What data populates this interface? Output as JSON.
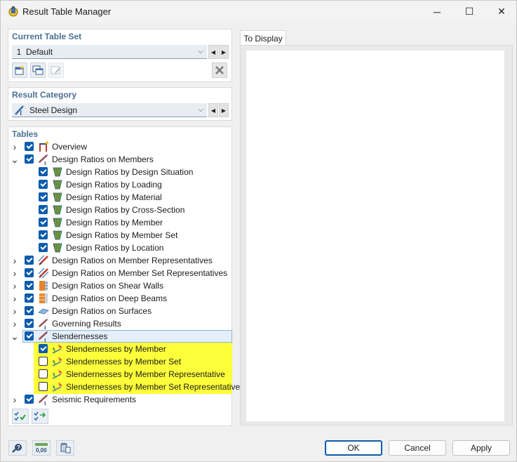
{
  "window": {
    "title": "Result Table Manager",
    "minimize_glyph": "─",
    "maximize_glyph": "☐",
    "close_glyph": "✕"
  },
  "table_set": {
    "section_title": "Current Table Set",
    "number": "1",
    "value": "Default"
  },
  "result_category": {
    "section_title": "Result Category",
    "value": "Steel Design"
  },
  "tables": {
    "section_title": "Tables",
    "items": [
      {
        "label": "Overview",
        "level": 0,
        "expander": "collapsed",
        "checked": true,
        "icon": "overview-icon"
      },
      {
        "label": "Design Ratios on Members",
        "level": 0,
        "expander": "expanded",
        "checked": true,
        "icon": "member-icon"
      },
      {
        "label": "Design Ratios by Design Situation",
        "level": 1,
        "checked": true,
        "icon": "design-ratio-icon"
      },
      {
        "label": "Design Ratios by Loading",
        "level": 1,
        "checked": true,
        "icon": "design-ratio-icon"
      },
      {
        "label": "Design Ratios by Material",
        "level": 1,
        "checked": true,
        "icon": "design-ratio-icon"
      },
      {
        "label": "Design Ratios by Cross-Section",
        "level": 1,
        "checked": true,
        "icon": "design-ratio-icon"
      },
      {
        "label": "Design Ratios by Member",
        "level": 1,
        "checked": true,
        "icon": "design-ratio-icon"
      },
      {
        "label": "Design Ratios by Member Set",
        "level": 1,
        "checked": true,
        "icon": "design-ratio-icon"
      },
      {
        "label": "Design Ratios by Location",
        "level": 1,
        "checked": true,
        "icon": "design-ratio-icon"
      },
      {
        "label": "Design Ratios on Member Representatives",
        "level": 0,
        "expander": "collapsed",
        "checked": true,
        "icon": "member-representative-icon"
      },
      {
        "label": "Design Ratios on Member Set Representatives",
        "level": 0,
        "expander": "collapsed",
        "checked": true,
        "icon": "member-set-representative-icon"
      },
      {
        "label": "Design Ratios on Shear Walls",
        "level": 0,
        "expander": "collapsed",
        "checked": true,
        "icon": "shear-wall-icon"
      },
      {
        "label": "Design Ratios on Deep Beams",
        "level": 0,
        "expander": "collapsed",
        "checked": true,
        "icon": "deep-beam-icon"
      },
      {
        "label": "Design Ratios on Surfaces",
        "level": 0,
        "expander": "collapsed",
        "checked": true,
        "icon": "surface-icon"
      },
      {
        "label": "Governing Results",
        "level": 0,
        "expander": "collapsed",
        "checked": true,
        "icon": "member-icon"
      },
      {
        "label": "Slendernesses",
        "level": 0,
        "expander": "expanded",
        "checked": true,
        "icon": "member-icon",
        "selected": true
      },
      {
        "label": "Slendernesses by Member",
        "level": 1,
        "checked": true,
        "icon": "slenderness-icon",
        "highlight": true
      },
      {
        "label": "Slendernesses by Member Set",
        "level": 1,
        "checked": false,
        "icon": "slenderness-icon",
        "highlight": true
      },
      {
        "label": "Slendernesses by Member Representative",
        "level": 1,
        "checked": false,
        "icon": "slenderness-icon",
        "highlight": true
      },
      {
        "label": "Slendernesses by Member Set Representative",
        "level": 1,
        "checked": false,
        "icon": "slenderness-icon",
        "highlight": true
      },
      {
        "label": "Seismic Requirements",
        "level": 0,
        "expander": "collapsed",
        "checked": true,
        "icon": "member-icon"
      }
    ]
  },
  "display": {
    "tab_label": "To Display"
  },
  "footer": {
    "ok_label": "OK",
    "cancel_label": "Cancel",
    "apply_label": "Apply",
    "units_icon_text": "0,00"
  },
  "colors": {
    "accent": "#0b5cad",
    "section_title": "#4a6f94",
    "highlight_yellow": "#fdff3a",
    "selection": "#e4effb"
  }
}
